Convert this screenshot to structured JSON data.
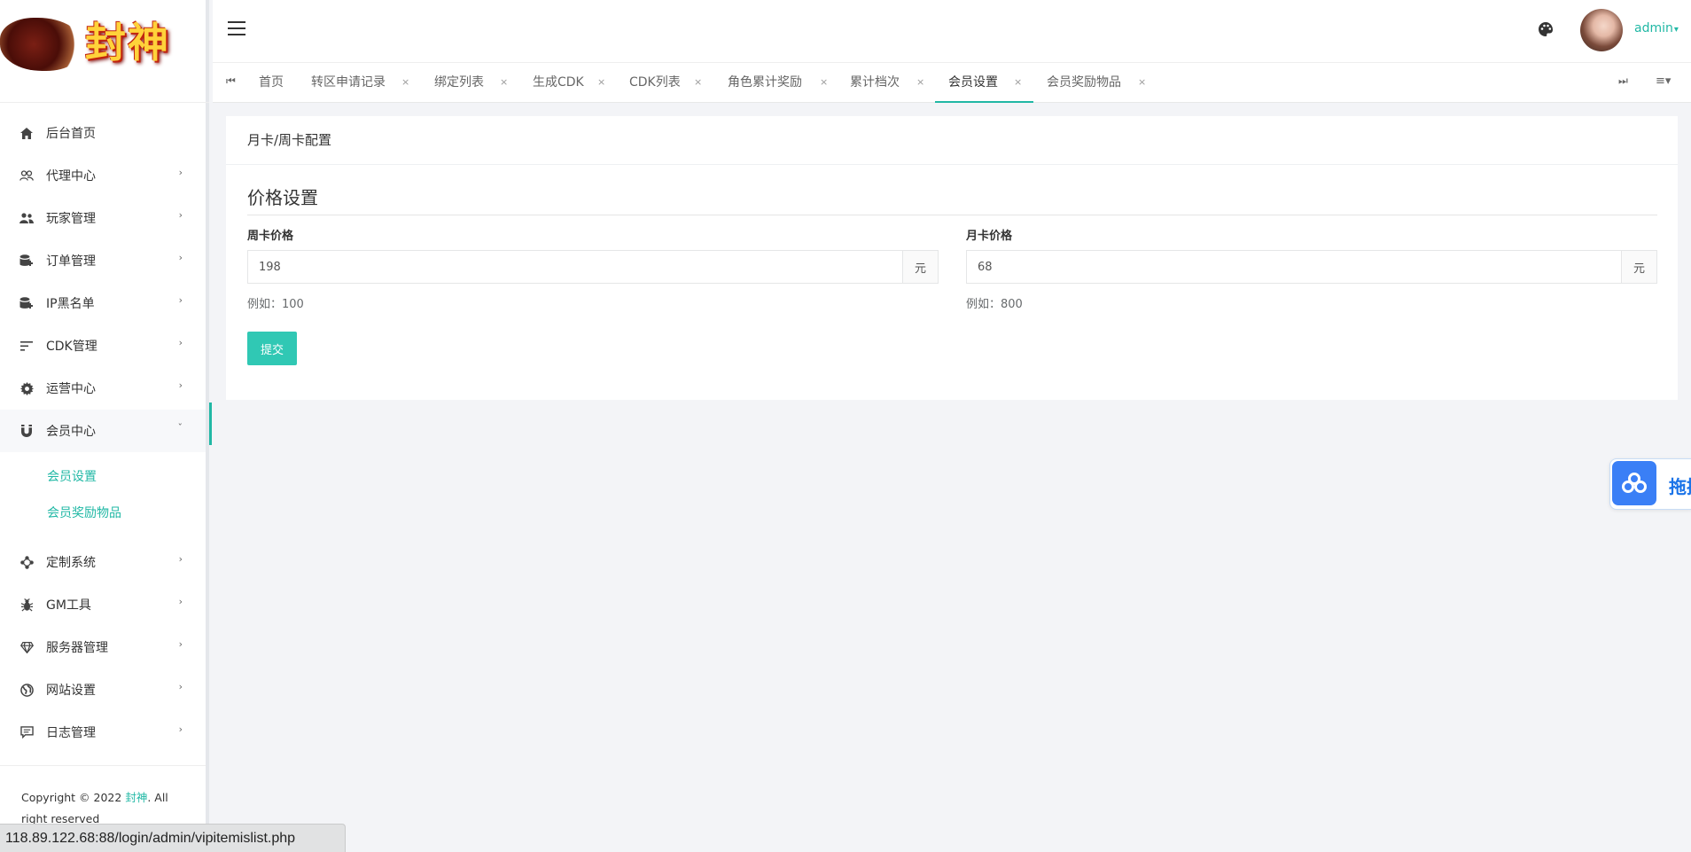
{
  "logo": {
    "text": "封神"
  },
  "sidebar": {
    "items": [
      {
        "label": "后台首页",
        "icon": "home-icon",
        "arrow": ""
      },
      {
        "label": "代理中心",
        "icon": "users-outline-icon",
        "arrow": "›"
      },
      {
        "label": "玩家管理",
        "icon": "users-icon",
        "arrow": "›"
      },
      {
        "label": "订单管理",
        "icon": "database-plus-icon",
        "arrow": "›"
      },
      {
        "label": "IP黑名单",
        "icon": "database-plus-icon",
        "arrow": "›"
      },
      {
        "label": "CDK管理",
        "icon": "sort-lines-icon",
        "arrow": "›"
      },
      {
        "label": "运营中心",
        "icon": "gear-icon",
        "arrow": "›"
      },
      {
        "label": "会员中心",
        "icon": "magnet-icon",
        "arrow": "ˇ"
      }
    ],
    "submenu": [
      "会员设置",
      "会员奖励物品"
    ],
    "items_after": [
      {
        "label": "定制系统",
        "icon": "nodes-icon",
        "arrow": "›"
      },
      {
        "label": "GM工具",
        "icon": "bug-icon",
        "arrow": "›"
      },
      {
        "label": "服务器管理",
        "icon": "diamond-icon",
        "arrow": "›"
      },
      {
        "label": "网站设置",
        "icon": "globe-icon",
        "arrow": "›"
      },
      {
        "label": "日志管理",
        "icon": "comment-icon",
        "arrow": "›"
      }
    ],
    "footer": {
      "prefix": "Copyright © 2022 ",
      "brand": "封神",
      "suffix": ". All right reserved"
    }
  },
  "header": {
    "user_name": "admin",
    "user_caret": "▾",
    "accent": "#21b8a5"
  },
  "tabs": {
    "prev_icon": "⏮",
    "next_icon": "⏭",
    "menu_icon": "≡▾",
    "items": [
      {
        "label": "首页",
        "closable": false
      },
      {
        "label": "转区申请记录",
        "closable": true
      },
      {
        "label": "绑定列表",
        "closable": true
      },
      {
        "label": "生成CDK",
        "closable": true
      },
      {
        "label": "CDK列表",
        "closable": true
      },
      {
        "label": "角色累计奖励",
        "closable": true
      },
      {
        "label": "累计档次",
        "closable": true
      },
      {
        "label": "会员设置",
        "closable": true,
        "active": true
      },
      {
        "label": "会员奖励物品",
        "closable": true
      }
    ],
    "close_glyph": "×"
  },
  "main": {
    "card_title": "月卡/周卡配置",
    "section_title": "价格设置",
    "weekly": {
      "label": "周卡价格",
      "value": "198",
      "unit": "元",
      "help": "例如：100"
    },
    "monthly": {
      "label": "月卡价格",
      "value": "68",
      "unit": "元",
      "help": "例如：800"
    },
    "submit_label": "提交",
    "submit_color": "#30c8b4"
  },
  "float_widget": {
    "text": "拖拽",
    "icon": "baidu-netdisk-icon"
  },
  "status_bar": {
    "url": "118.89.122.68:88/login/admin/vipitemislist.php"
  }
}
